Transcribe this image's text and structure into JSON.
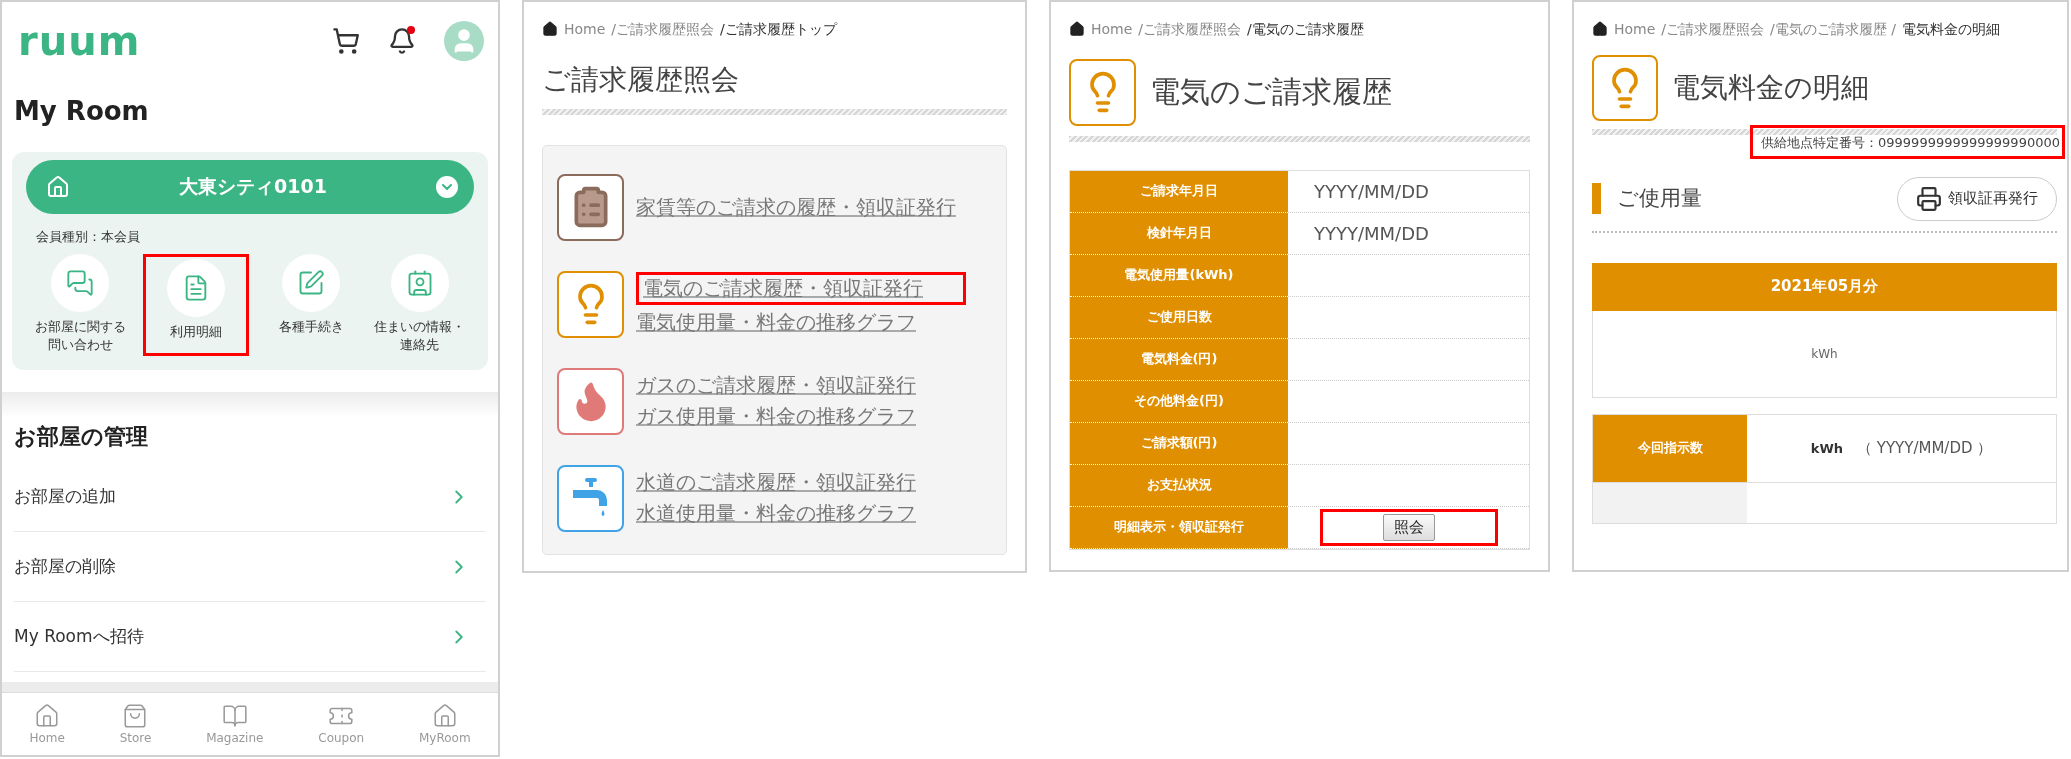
{
  "my_room_screen": {
    "logo": "ruum",
    "title": "My Room",
    "room_selector": {
      "name": "大東シティ0101"
    },
    "membership": "会員種別：本会員",
    "shortcuts": [
      {
        "kind": "inquiry",
        "label": "お部屋に関する問い合わせ",
        "highlighted": false
      },
      {
        "kind": "statement",
        "label": "利用明細",
        "highlighted": true
      },
      {
        "kind": "procedures",
        "label": "各種手続き",
        "highlighted": false
      },
      {
        "kind": "info",
        "label": "住まいの情報・連絡先",
        "highlighted": false
      }
    ],
    "section_title": "お部屋の管理",
    "menu_items": [
      "お部屋の追加",
      "お部屋の削除",
      "My Roomへ招待"
    ],
    "bottom_nav": [
      {
        "kind": "home",
        "label": "Home"
      },
      {
        "kind": "store",
        "label": "Store"
      },
      {
        "kind": "magazine",
        "label": "Magazine"
      },
      {
        "kind": "coupon",
        "label": "Coupon"
      },
      {
        "kind": "myroom",
        "label": "MyRoom"
      }
    ]
  },
  "billing_top_screen": {
    "breadcrumb": [
      "Home",
      "/ご請求履歴照会",
      "/ご請求履歴トップ"
    ],
    "title": "ご請求履歴照会",
    "menu": [
      {
        "kind": "rent",
        "links": [
          {
            "text": "家賃等のご請求の履歴・領収証発行",
            "highlighted": false
          }
        ]
      },
      {
        "kind": "electricity",
        "links": [
          {
            "text": "電気のご請求履歴・領収証発行",
            "highlighted": true
          },
          {
            "text": "電気使用量・料金の推移グラフ",
            "highlighted": false
          }
        ]
      },
      {
        "kind": "gas",
        "links": [
          {
            "text": "ガスのご請求履歴・領収証発行",
            "highlighted": false
          },
          {
            "text": "ガス使用量・料金の推移グラフ",
            "highlighted": false
          }
        ]
      },
      {
        "kind": "water",
        "links": [
          {
            "text": "水道のご請求履歴・領収証発行",
            "highlighted": false
          },
          {
            "text": "水道使用量・料金の推移グラフ",
            "highlighted": false
          }
        ]
      }
    ]
  },
  "electric_history_screen": {
    "breadcrumb": [
      "Home",
      "/ご請求履歴照会",
      "/電気のご請求履歴"
    ],
    "title": "電気のご請求履歴",
    "rows": [
      {
        "kind": "text",
        "label": "ご請求年月日",
        "value": "YYYY/MM/DD"
      },
      {
        "kind": "text",
        "label": "検針年月日",
        "value": "YYYY/MM/DD"
      },
      {
        "kind": "text",
        "label": "電気使用量(kWh)"
      },
      {
        "kind": "text",
        "label": "ご使用日数"
      },
      {
        "kind": "text",
        "label": "電気料金(円)"
      },
      {
        "kind": "text",
        "label": "その他料金(円)"
      },
      {
        "kind": "text",
        "label": "ご請求額(円)"
      },
      {
        "kind": "text",
        "label": "お支払状況"
      },
      {
        "kind": "button",
        "label": "明細表示・領収証発行",
        "button": "照会",
        "highlighted": true
      }
    ]
  },
  "electric_detail_screen": {
    "breadcrumb": [
      "Home",
      "/ご請求履歴照会",
      "/電気のご請求履歴 /",
      "電気料金の明細"
    ],
    "title": "電気料金の明細",
    "supply_point": {
      "text": "供給地点特定番号：0999999999999999990000",
      "highlighted": true
    },
    "section_title": "ご使用量",
    "reissue_button": "領収証再発行",
    "month": "2021年05月分",
    "usage": "kWh",
    "readings": [
      {
        "label": "今回指示数",
        "unit": "kWh",
        "date": "（ YYYY/MM/DD ）"
      }
    ]
  }
}
